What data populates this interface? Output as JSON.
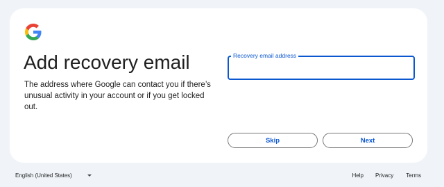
{
  "logo": {
    "icon": "google-g-icon",
    "colors": {
      "blue": "#4285F4",
      "red": "#EA4335",
      "yellow": "#FBBC05",
      "green": "#34A853"
    }
  },
  "page": {
    "title": "Add recovery email",
    "description": "The address where Google can contact you if there’s unusual activity in your account or if you get locked out."
  },
  "form": {
    "email_label": "Recovery email address",
    "email_value": ""
  },
  "actions": {
    "skip_label": "Skip",
    "next_label": "Next"
  },
  "footer": {
    "language": "English (United States)",
    "language_icon": "caret-down-icon",
    "links": [
      "Help",
      "Privacy",
      "Terms"
    ]
  },
  "colors": {
    "accent": "#0b57d0",
    "background": "#f0f4f9",
    "card": "#ffffff"
  }
}
